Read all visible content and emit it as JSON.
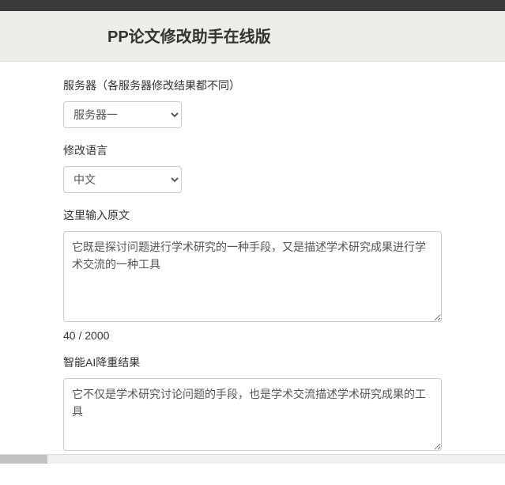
{
  "header": {
    "title": "PP论文修改助手在线版"
  },
  "form": {
    "server": {
      "label": "服务器（各服务器修改结果都不同）",
      "selected": "服务器一"
    },
    "language": {
      "label": "修改语言",
      "selected": "中文"
    },
    "input": {
      "label": "这里输入原文",
      "value": "它既是探讨问题进行学术研究的一种手段，又是描述学术研究成果进行学术交流的一种工具"
    },
    "counter": "40 / 2000",
    "output": {
      "label": "智能AI降重结果",
      "value": "它不仅是学术研究讨论问题的手段，也是学术交流描述学术研究成果的工具"
    }
  }
}
